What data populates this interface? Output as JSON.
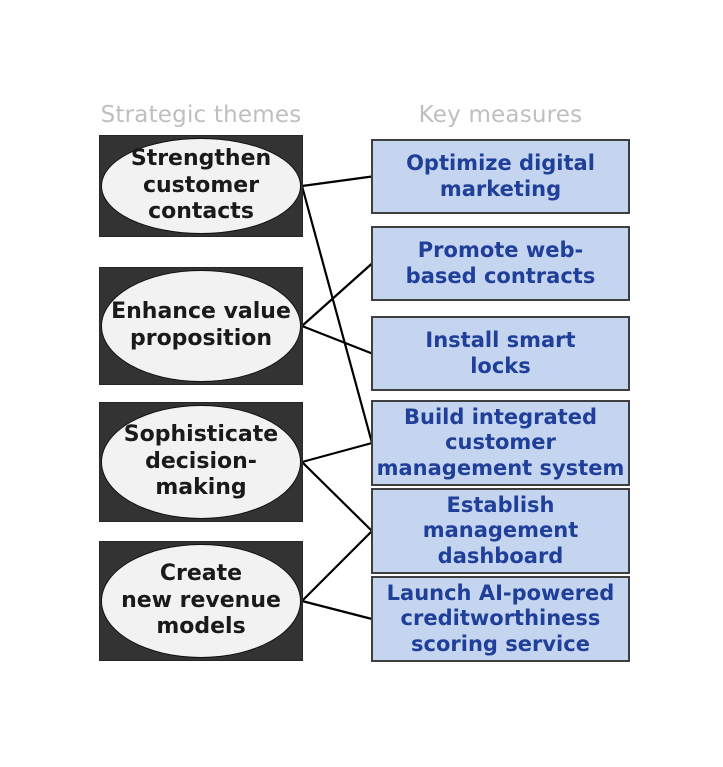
{
  "headers": {
    "themes": "Strategic themes",
    "measures": "Key measures"
  },
  "colors": {
    "header_text": "#bfbfbf",
    "theme_rect_fill": "#333333",
    "theme_ellipse_fill": "#f2f2f2",
    "theme_text": "#1a1a1a",
    "measure_fill": "#c5d5ef",
    "measure_border": "#3f3f3f",
    "measure_text": "#1f3f99",
    "connector": "#000000"
  },
  "themes": [
    {
      "id": "strengthen-customer-contacts",
      "label": "Strengthen\ncustomer\ncontacts"
    },
    {
      "id": "enhance-value-proposition",
      "label": "Enhance value\nproposition"
    },
    {
      "id": "sophisticate-decision-making",
      "label": "Sophisticate\ndecision-\nmaking"
    },
    {
      "id": "create-new-revenue-models",
      "label": "Create\nnew revenue\nmodels"
    }
  ],
  "measures": [
    {
      "id": "optimize-digital-marketing",
      "label": "Optimize digital\nmarketing"
    },
    {
      "id": "promote-web-based-contracts",
      "label": "Promote web-\nbased contracts"
    },
    {
      "id": "install-smart-locks",
      "label": "Install smart\nlocks"
    },
    {
      "id": "build-integrated-cms",
      "label": "Build integrated\ncustomer\nmanagement system"
    },
    {
      "id": "establish-management-dashboard",
      "label": "Establish\nmanagement\ndashboard"
    },
    {
      "id": "launch-ai-credit-scoring",
      "label": "Launch AI-powered\ncreditworthiness\nscoring service"
    }
  ],
  "connections": [
    {
      "from": "strengthen-customer-contacts",
      "to": "optimize-digital-marketing"
    },
    {
      "from": "strengthen-customer-contacts",
      "to": "build-integrated-cms"
    },
    {
      "from": "enhance-value-proposition",
      "to": "promote-web-based-contracts"
    },
    {
      "from": "enhance-value-proposition",
      "to": "install-smart-locks"
    },
    {
      "from": "sophisticate-decision-making",
      "to": "build-integrated-cms"
    },
    {
      "from": "sophisticate-decision-making",
      "to": "establish-management-dashboard"
    },
    {
      "from": "create-new-revenue-models",
      "to": "establish-management-dashboard"
    },
    {
      "from": "create-new-revenue-models",
      "to": "launch-ai-credit-scoring"
    }
  ]
}
